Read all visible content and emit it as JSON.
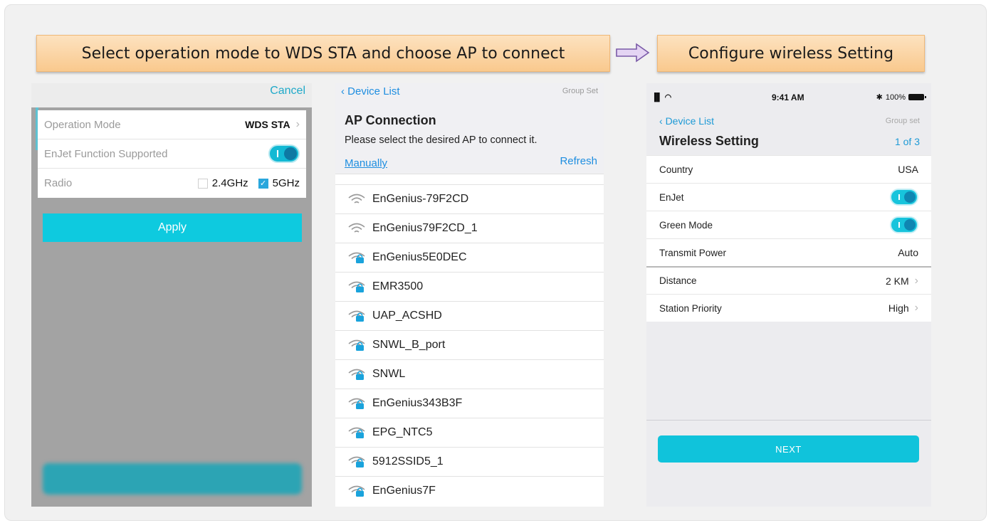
{
  "banners": {
    "left": "Select operation mode to WDS STA and choose AP to connect",
    "right": "Configure wireless Setting"
  },
  "panel1": {
    "cancel": "Cancel",
    "rows": {
      "operation_mode_label": "Operation Mode",
      "operation_mode_value": "WDS STA",
      "enjet_label": "EnJet Function Supported",
      "radio_label": "Radio",
      "radio_opt1": "2.4GHz",
      "radio_opt2": "5GHz"
    },
    "apply": "Apply"
  },
  "panel2": {
    "back": "Device List",
    "group_set": "Group Set",
    "title": "AP Connection",
    "subtitle": "Please select the desired AP to connect it.",
    "manually": "Manually",
    "refresh": "Refresh",
    "aps": [
      {
        "name": "EnGenius-79F2CD",
        "locked": false
      },
      {
        "name": "EnGenius79F2CD_1",
        "locked": false
      },
      {
        "name": "EnGenius5E0DEC",
        "locked": true
      },
      {
        "name": "EMR3500",
        "locked": true
      },
      {
        "name": "UAP_ACSHD",
        "locked": true
      },
      {
        "name": "SNWL_B_port",
        "locked": true
      },
      {
        "name": "SNWL",
        "locked": true
      },
      {
        "name": "EnGenius343B3F",
        "locked": true
      },
      {
        "name": "EPG_NTC5",
        "locked": true
      },
      {
        "name": "5912SSID5_1",
        "locked": true
      },
      {
        "name": "EnGenius7F",
        "locked": true
      }
    ]
  },
  "panel3": {
    "status": {
      "time": "9:41 AM",
      "battery": "100%"
    },
    "back": "Device List",
    "group_set": "Group set",
    "title": "Wireless Setting",
    "count": "1 of 3",
    "rows": {
      "country_label": "Country",
      "country_value": "USA",
      "enjet_label": "EnJet",
      "green_label": "Green Mode",
      "tx_label": "Transmit Power",
      "tx_value": "Auto",
      "distance_label": "Distance",
      "distance_value": "2 KM",
      "priority_label": "Station Priority",
      "priority_value": "High"
    },
    "next": "NEXT"
  }
}
